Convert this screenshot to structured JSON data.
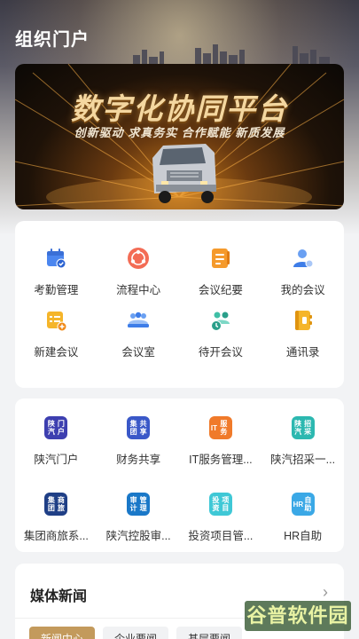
{
  "header": {
    "title": "组织门户"
  },
  "banner": {
    "title": "数字化协同平台",
    "subtitle": "创新驱动 求真务实 合作赋能 新质发展"
  },
  "office": {
    "items": [
      {
        "label": "考勤管理",
        "icon": "calendar-check-icon"
      },
      {
        "label": "流程中心",
        "icon": "process-flow-icon"
      },
      {
        "label": "会议纪要",
        "icon": "meeting-notes-icon"
      },
      {
        "label": "我的会议",
        "icon": "user-meeting-icon"
      },
      {
        "label": "新建会议",
        "icon": "new-meeting-icon"
      },
      {
        "label": "会议室",
        "icon": "meeting-room-icon"
      },
      {
        "label": "待开会议",
        "icon": "pending-meeting-icon"
      },
      {
        "label": "通讯录",
        "icon": "contacts-book-icon"
      }
    ]
  },
  "apps": {
    "items": [
      {
        "label": "陕汽门户",
        "icon_text": [
          "陕汽",
          "门户"
        ],
        "color": "#3d3fb0"
      },
      {
        "label": "财务共享",
        "icon_text": [
          "集团",
          "共享"
        ],
        "color": "#3a58c8"
      },
      {
        "label": "IT服务管理...",
        "icon_text": [
          "IT",
          "服务"
        ],
        "color": "#f07a2a"
      },
      {
        "label": "陕汽招采一...",
        "icon_text": [
          "陕汽",
          "招采"
        ],
        "color": "#2cb8b0"
      },
      {
        "label": "集团商旅系...",
        "icon_text": [
          "集团",
          "商旅"
        ],
        "color": "#1f3f86"
      },
      {
        "label": "陕汽控股审...",
        "icon_text": [
          "审计",
          "管理"
        ],
        "color": "#1a78c8"
      },
      {
        "label": "投资项目管...",
        "icon_text": [
          "投资",
          "项目"
        ],
        "color": "#3fc8d6"
      },
      {
        "label": "HR自助",
        "icon_text": [
          "HR",
          "自助"
        ],
        "color": "#3aa8e6"
      }
    ]
  },
  "news": {
    "title": "媒体新闻",
    "more": "›",
    "tabs": [
      "新闻中心",
      "企业要闻",
      "基层要闻"
    ]
  },
  "watermark": {
    "text": "谷普软件园"
  }
}
